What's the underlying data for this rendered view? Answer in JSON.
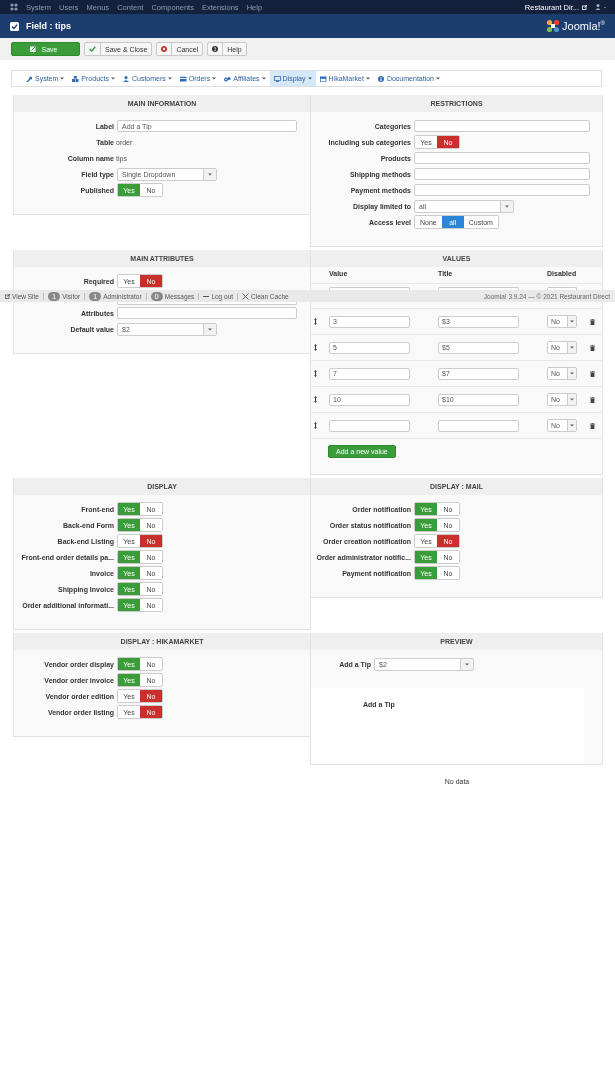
{
  "top_menu": {
    "items": [
      "System",
      "Users",
      "Menus",
      "Content",
      "Components",
      "Extensions",
      "Help"
    ],
    "site": "Restaurant Dir..."
  },
  "header": {
    "title": "Field : tips",
    "logo": "Joomla!$^{®}$"
  },
  "toolbar": {
    "buttons": [
      {
        "label": "Save",
        "kind": "save"
      },
      {
        "label": "Save & Close",
        "kind": "check"
      },
      {
        "label": "Cancel",
        "kind": "cancel"
      },
      {
        "label": "Help",
        "kind": "help"
      }
    ]
  },
  "nav": {
    "items": [
      {
        "label": "System",
        "selected": false
      },
      {
        "label": "Products",
        "selected": false
      },
      {
        "label": "Customers",
        "selected": false
      },
      {
        "label": "Orders",
        "selected": false
      },
      {
        "label": "Affiliates",
        "selected": false
      },
      {
        "label": "Display",
        "selected": true
      },
      {
        "label": "HikaMarket",
        "selected": false
      },
      {
        "label": "Documentation",
        "selected": false
      }
    ]
  },
  "panels": [
    {
      "kind": "form",
      "title": "MAIN INFORMATION",
      "rows": [
        {
          "kind": "input",
          "label": "Label",
          "value": "Add a Tip"
        },
        {
          "kind": "text",
          "label": "Table",
          "text": "order"
        },
        {
          "kind": "text",
          "label": "Column name",
          "text": "tips"
        },
        {
          "kind": "select",
          "label": "Field type",
          "value": "Single Dropdown"
        },
        {
          "kind": "toggle",
          "label": "Published",
          "options": [
            {
              "label": "Yes",
              "selected": true
            },
            {
              "label": "No",
              "selected": false
            }
          ]
        }
      ]
    },
    {
      "kind": "form",
      "title": "RESTRICTIONS",
      "rows": [
        {
          "kind": "input",
          "label": "Categories"
        },
        {
          "kind": "toggle",
          "label": "Including sub categories",
          "options": [
            {
              "label": "Yes",
              "selected": false
            },
            {
              "label": "No",
              "selected": true
            }
          ]
        },
        {
          "kind": "input",
          "label": "Products"
        },
        {
          "kind": "input",
          "label": "Shipping methods"
        },
        {
          "kind": "input",
          "label": "Payment methods"
        },
        {
          "kind": "select",
          "label": "Display limited to",
          "value": "all"
        },
        {
          "kind": "choice",
          "label": "Access level",
          "options": [
            {
              "label": "None",
              "selected": false
            },
            {
              "label": "all",
              "selected": true
            },
            {
              "label": "Custom",
              "selected": false
            }
          ]
        }
      ]
    },
    {
      "kind": "form",
      "title": "MAIN ATTRIBUTES",
      "rows": [
        {
          "kind": "toggle",
          "label": "Required",
          "options": [
            {
              "label": "Yes",
              "selected": false
            },
            {
              "label": "No",
              "selected": true
            }
          ]
        },
        {
          "kind": "covered_input"
        },
        {
          "kind": "input",
          "label": "Attributes"
        },
        {
          "kind": "select",
          "label": "Default value",
          "value": "$2"
        }
      ]
    },
    {
      "kind": "values",
      "title": "VALUES",
      "columns": [
        "Value",
        "Title",
        "Disabled"
      ],
      "rows": [
        {
          "covered": true
        },
        {
          "value": "3",
          "title": "$3",
          "disabled": "No"
        },
        {
          "value": "5",
          "title": "$5",
          "disabled": "No"
        },
        {
          "value": "7",
          "title": "$7",
          "disabled": "No"
        },
        {
          "value": "10",
          "title": "$10",
          "disabled": "No"
        },
        {
          "disabled": "No"
        }
      ],
      "add_button": "Add a new value"
    },
    {
      "kind": "form",
      "title": "DISPLAY",
      "rows": [
        {
          "kind": "toggle",
          "label": "Front-end",
          "options": [
            {
              "label": "Yes",
              "selected": true
            },
            {
              "label": "No",
              "selected": false
            }
          ]
        },
        {
          "kind": "toggle",
          "label": "Back-end Form",
          "options": [
            {
              "label": "Yes",
              "selected": true
            },
            {
              "label": "No",
              "selected": false
            }
          ]
        },
        {
          "kind": "toggle",
          "label": "Back-end Listing",
          "options": [
            {
              "label": "Yes",
              "selected": false
            },
            {
              "label": "No",
              "selected": true
            }
          ]
        },
        {
          "kind": "toggle",
          "label": "Front-end order details pa...",
          "options": [
            {
              "label": "Yes",
              "selected": true
            },
            {
              "label": "No",
              "selected": false
            }
          ]
        },
        {
          "kind": "toggle",
          "label": "Invoice",
          "options": [
            {
              "label": "Yes",
              "selected": true
            },
            {
              "label": "No",
              "selected": false
            }
          ]
        },
        {
          "kind": "toggle",
          "label": "Shipping Invoice",
          "options": [
            {
              "label": "Yes",
              "selected": true
            },
            {
              "label": "No",
              "selected": false
            }
          ]
        },
        {
          "kind": "toggle",
          "label": "Order additional informati...",
          "options": [
            {
              "label": "Yes",
              "selected": true
            },
            {
              "label": "No",
              "selected": false
            }
          ]
        }
      ]
    },
    {
      "kind": "form",
      "title": "DISPLAY : MAIL",
      "rows": [
        {
          "kind": "toggle",
          "label": "Order notification",
          "options": [
            {
              "label": "Yes",
              "selected": true
            },
            {
              "label": "No",
              "selected": false
            }
          ]
        },
        {
          "kind": "toggle",
          "label": "Order status notification",
          "options": [
            {
              "label": "Yes",
              "selected": true
            },
            {
              "label": "No",
              "selected": false
            }
          ]
        },
        {
          "kind": "toggle",
          "label": "Order creation notification",
          "options": [
            {
              "label": "Yes",
              "selected": false
            },
            {
              "label": "No",
              "selected": true
            }
          ]
        },
        {
          "kind": "toggle",
          "label": "Order administrator notific...",
          "options": [
            {
              "label": "Yes",
              "selected": true
            },
            {
              "label": "No",
              "selected": false
            }
          ]
        },
        {
          "kind": "toggle",
          "label": "Payment notification",
          "options": [
            {
              "label": "Yes",
              "selected": true
            },
            {
              "label": "No",
              "selected": false
            }
          ]
        }
      ]
    },
    {
      "kind": "form",
      "title": "DISPLAY : HIKAMARKET",
      "rows": [
        {
          "kind": "toggle",
          "label": "Vendor order display",
          "options": [
            {
              "label": "Yes",
              "selected": true
            },
            {
              "label": "No",
              "selected": false
            }
          ]
        },
        {
          "kind": "toggle",
          "label": "Vendor order invoice",
          "options": [
            {
              "label": "Yes",
              "selected": true
            },
            {
              "label": "No",
              "selected": false
            }
          ]
        },
        {
          "kind": "toggle",
          "label": "Vendor order edition",
          "options": [
            {
              "label": "Yes",
              "selected": false
            },
            {
              "label": "No",
              "selected": true
            }
          ]
        },
        {
          "kind": "toggle",
          "label": "Vendor order listing",
          "options": [
            {
              "label": "Yes",
              "selected": false
            },
            {
              "label": "No",
              "selected": true
            }
          ]
        }
      ]
    },
    {
      "kind": "preview",
      "title": "PREVIEW",
      "field": {
        "label": "Add a Tip",
        "value": "$2"
      },
      "box_title": "Add a Tip",
      "note": "No data"
    }
  ],
  "status_bar": {
    "items": [
      {
        "kind": "link",
        "label": "View Site"
      },
      {
        "kind": "count",
        "badge": "1",
        "label": "Visitor"
      },
      {
        "kind": "count",
        "badge": "1",
        "label": "Administrator"
      },
      {
        "kind": "count",
        "badge": "0",
        "label": "Messages"
      },
      {
        "kind": "logout",
        "label": "Log out"
      },
      {
        "kind": "cache",
        "label": "Clean Cache"
      }
    ],
    "copyright": "Joomla! 3.9.24 — © 2021 Restaurant Direct"
  }
}
